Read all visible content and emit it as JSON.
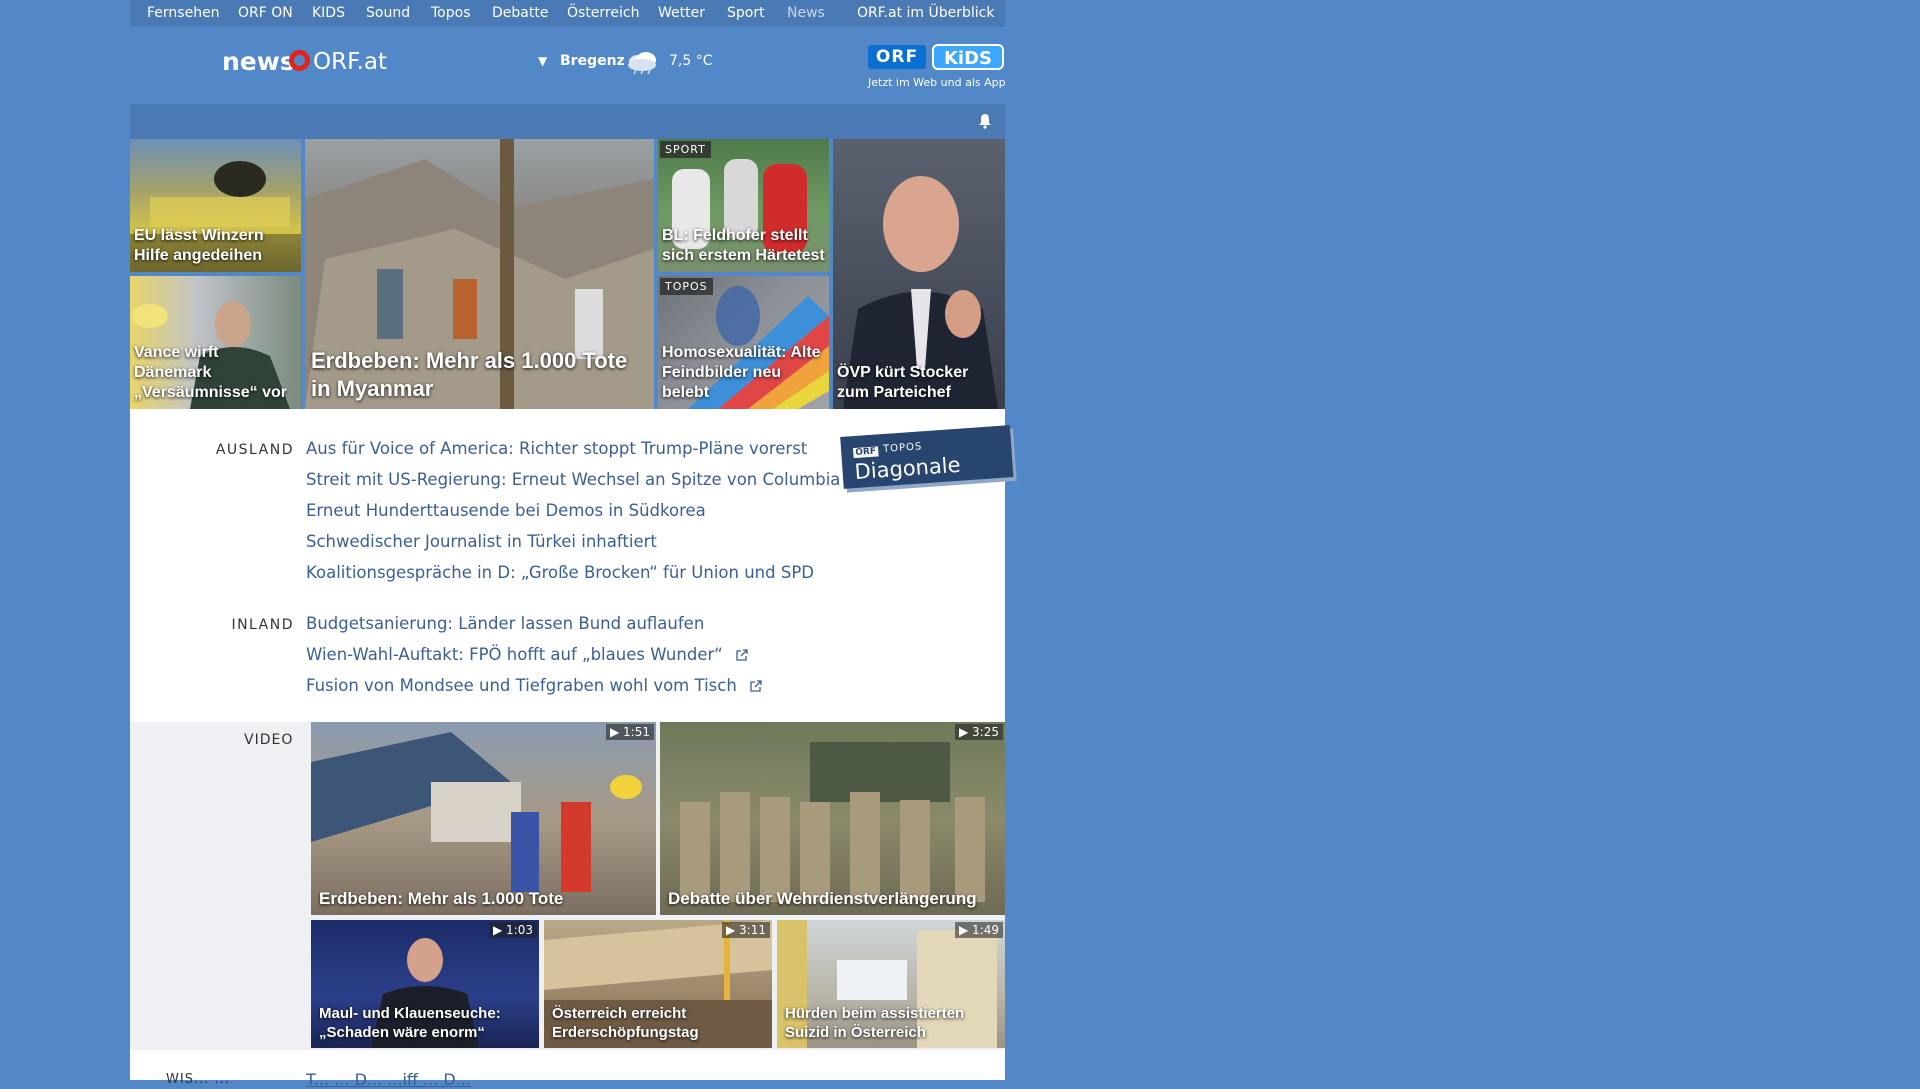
{
  "topnav": {
    "items": [
      "Fernsehen",
      "ORF ON",
      "KIDS",
      "Sound",
      "Topos",
      "Debatte",
      "Österreich",
      "Wetter",
      "Sport",
      "News",
      "ORF.at im Überblick"
    ],
    "active": "News"
  },
  "header": {
    "logo_news": "news",
    "logo_orf": "ORF.at",
    "weather": {
      "city": "Bregenz",
      "temp": "7,5 °C",
      "icon": "cloud-rain-icon"
    },
    "kids": {
      "orf": "ORF",
      "kids": "KiDS",
      "tagline": "Jetzt im Web und als App"
    }
  },
  "tiles": {
    "t1": "EU lässt Winzern Hilfe angedeihen",
    "t2": "Vance wirft Dänemark „Versäumnisse“ vor",
    "main": "Erdbeben: Mehr als 1.000 Tote in Myanmar",
    "t3_badge": "SPORT",
    "t3": "BL: Feldhofer stellt sich erstem Härtetest",
    "t4_badge": "TOPOS",
    "t4": "Homosexualität: Alte Feindbilder neu belebt",
    "t5": "ÖVP kürt Stocker zum Parteichef"
  },
  "sections": {
    "ausland": {
      "label": "AUSLAND",
      "links": [
        "Aus für Voice of America: Richter stoppt Trump-Pläne vorerst",
        "Streit mit US-Regierung: Erneut Wechsel an Spitze von Columbia",
        "Erneut Hunderttausende bei Demos in Südkorea",
        "Schwedischer Journalist in Türkei inhaftiert",
        "Koalitionsgespräche in D: „Große Brocken“ für Union und SPD"
      ]
    },
    "inland": {
      "label": "INLAND",
      "links": [
        "Budgetsanierung: Länder lassen Bund auflaufen",
        "Wien-Wahl-Auftakt: FPÖ hofft auf „blaues Wunder“",
        "Fusion von Mondsee und Tiefgraben wohl vom Tisch"
      ]
    }
  },
  "promo": {
    "orf": "ORF",
    "topos": "TOPOS",
    "title": "Diagonale"
  },
  "video": {
    "label": "VIDEO",
    "items": [
      {
        "title": "Erdbeben: Mehr als 1.000 Tote",
        "duration": "1:51"
      },
      {
        "title": "Debatte über Wehrdienstverlängerung",
        "duration": "3:25"
      },
      {
        "title": "Maul- und Klauenseuche: „Schaden wäre enorm“",
        "duration": "1:03"
      },
      {
        "title": "Österreich erreicht Erderschöpfungstag",
        "duration": "3:11"
      },
      {
        "title": "Hürden beim assistierten Suizid in Österreich",
        "duration": "1:49"
      }
    ]
  },
  "below": {
    "label": "WIS... ...",
    "link": "T... ... D... ...iff ... D..."
  },
  "colors": {
    "background": "#5287c8",
    "link": "#3a5f95",
    "logo_red": "#e2231a"
  }
}
